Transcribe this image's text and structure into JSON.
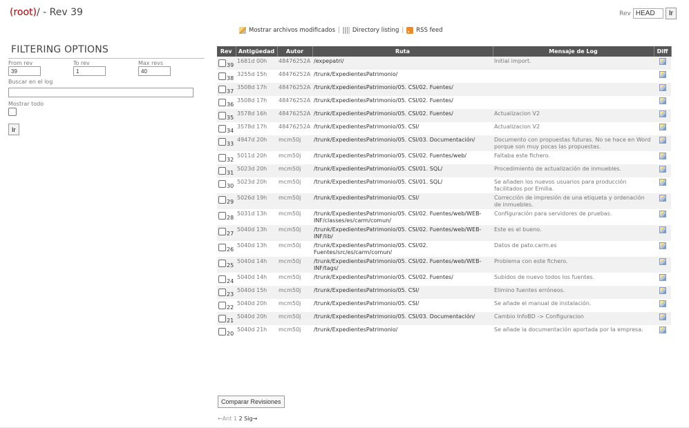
{
  "header": {
    "root_link": "(root)",
    "title_rest": "/ - Rev 39",
    "rev_label": "Rev",
    "rev_value": "HEAD",
    "go_label": "Ir"
  },
  "toplinks": {
    "modified": "Mostrar archivos modificados",
    "directory": "Directory listing",
    "rss": "RSS feed",
    "sep": "|"
  },
  "filter": {
    "heading": "FILTERING OPTIONS",
    "from_label": "From rev",
    "to_label": "To rev",
    "max_label": "Max revs",
    "from_value": "39",
    "to_value": "1",
    "max_value": "40",
    "search_label": "Buscar en el log",
    "showall_label": "Mostrar todo",
    "go_label": "Ir"
  },
  "table": {
    "headers": [
      "Rev",
      "Antigüedad",
      "Autor",
      "Ruta",
      "Mensaje de Log",
      "Diff"
    ],
    "rows": [
      {
        "rev": "39",
        "age": "1681d 00h",
        "author": "48476252A",
        "path": "/expepatri/",
        "msg": "Initial import."
      },
      {
        "rev": "38",
        "age": "3255d 15h",
        "author": "48476252A",
        "path": "/trunk/ExpedientesPatrimonio/",
        "msg": ""
      },
      {
        "rev": "37",
        "age": "3508d 17h",
        "author": "48476252A",
        "path": "/trunk/ExpedientesPatrimonio/05. CSI/02. Fuentes/",
        "msg": ""
      },
      {
        "rev": "36",
        "age": "3508d 17h",
        "author": "48476252A",
        "path": "/trunk/ExpedientesPatrimonio/05. CSI/02. Fuentes/",
        "msg": ""
      },
      {
        "rev": "35",
        "age": "3578d 16h",
        "author": "48476252A",
        "path": "/trunk/ExpedientesPatrimonio/05. CSI/02. Fuentes/",
        "msg": "Actualizacion V2"
      },
      {
        "rev": "34",
        "age": "3578d 17h",
        "author": "48476252A",
        "path": "/trunk/ExpedientesPatrimonio/05. CSI/",
        "msg": "Actualizacion V2"
      },
      {
        "rev": "33",
        "age": "4947d 20h",
        "author": "mcm50j",
        "path": "/trunk/ExpedientesPatrimonio/05. CSI/03. Documentación/",
        "msg": "Documento con propuestas futuras. No se hace en Word porque son muy pocas las propuestas."
      },
      {
        "rev": "32",
        "age": "5011d 20h",
        "author": "mcm50j",
        "path": "/trunk/ExpedientesPatrimonio/05. CSI/02. Fuentes/web/",
        "msg": "Faltaba este fichero."
      },
      {
        "rev": "31",
        "age": "5023d 20h",
        "author": "mcm50j",
        "path": "/trunk/ExpedientesPatrimonio/05. CSI/01. SQL/",
        "msg": "Procedimiento de actualización de inmuebles."
      },
      {
        "rev": "30",
        "age": "5023d 20h",
        "author": "mcm50j",
        "path": "/trunk/ExpedientesPatrimonio/05. CSI/01. SQL/",
        "msg": "Se añaden los nuevos usuarios para producción facilitados por Emilia."
      },
      {
        "rev": "29",
        "age": "5026d 19h",
        "author": "mcm50j",
        "path": "/trunk/ExpedientesPatrimonio/05. CSI/",
        "msg": "Corrección de impresión de una etiqueta y ordenación de inmuebles."
      },
      {
        "rev": "28",
        "age": "5031d 13h",
        "author": "mcm50j",
        "path": "/trunk/ExpedientesPatrimonio/05. CSI/02. Fuentes/web/WEB-INF/classes/es/carm/comun/",
        "msg": "Configuración para servidores de pruebas."
      },
      {
        "rev": "27",
        "age": "5040d 13h",
        "author": "mcm50j",
        "path": "/trunk/ExpedientesPatrimonio/05. CSI/02. Fuentes/web/WEB-INF/lib/",
        "msg": "Este es el bueno."
      },
      {
        "rev": "26",
        "age": "5040d 13h",
        "author": "mcm50j",
        "path": "/trunk/ExpedientesPatrimonio/05. CSI/02. Fuentes/src/es/carm/comun/",
        "msg": "Datos de pato.carm.es"
      },
      {
        "rev": "25",
        "age": "5040d 14h",
        "author": "mcm50j",
        "path": "/trunk/ExpedientesPatrimonio/05. CSI/02. Fuentes/web/WEB-INF/tags/",
        "msg": "Problema con este fichero."
      },
      {
        "rev": "24",
        "age": "5040d 14h",
        "author": "mcm50j",
        "path": "/trunk/ExpedientesPatrimonio/05. CSI/02. Fuentes/",
        "msg": "Subidos de nuevo todos los fuentes."
      },
      {
        "rev": "23",
        "age": "5040d 15h",
        "author": "mcm50j",
        "path": "/trunk/ExpedientesPatrimonio/05. CSI/",
        "msg": "Elimino fuentes erróneos."
      },
      {
        "rev": "22",
        "age": "5040d 20h",
        "author": "mcm50j",
        "path": "/trunk/ExpedientesPatrimonio/05. CSI/",
        "msg": "Se añade el manual de instalación."
      },
      {
        "rev": "21",
        "age": "5040d 20h",
        "author": "mcm50j",
        "path": "/trunk/ExpedientesPatrimonio/05. CSI/03. Documentación/",
        "msg": "Cambio InfoBD -> Configuracion"
      },
      {
        "rev": "20",
        "age": "5040d 21h",
        "author": "mcm50j",
        "path": "/trunk/ExpedientesPatrimonio/",
        "msg": "Se añade la documentación aportada por la empresa."
      }
    ]
  },
  "compare_label": "Comparar Revisiones",
  "pager": {
    "prev": "←Ant",
    "p1": "1",
    "p2": "2",
    "next": "Sig→"
  }
}
